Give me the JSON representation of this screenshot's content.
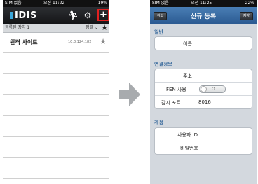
{
  "left_screen": {
    "status": {
      "carrier": "SIM 없음",
      "time": "오전 11:22",
      "battery": "19%"
    },
    "app_title": "IDIS",
    "icons": {
      "run": "running-person-icon",
      "settings": "gear-icon",
      "add": "plus-icon"
    },
    "subheader": {
      "label": "등록된 장치 1",
      "sort": "정렬 ⌄"
    },
    "devices": [
      {
        "name": "원격 사이트",
        "ip": "10.0.124.182"
      }
    ],
    "empty_rows": 6
  },
  "right_screen": {
    "status": {
      "carrier": "SIM 없음",
      "time": "오전 11:25",
      "battery": "22%"
    },
    "title": "신규 등록",
    "cancel_label": "취소",
    "save_label": "저장",
    "sections": {
      "general": {
        "title": "일반",
        "name_label": "이름"
      },
      "connection": {
        "title": "연결정보",
        "address_label": "주소",
        "fen_label": "FEN 사용",
        "fen_toggle": "O",
        "port_label": "감시 포트",
        "port_value": "8016"
      },
      "account": {
        "title": "계정",
        "user_label": "사용자 ID",
        "password_label": "비밀번호"
      }
    }
  },
  "colors": {
    "highlight": "#e02020",
    "section_text": "#3d6d9e",
    "nav_blue": "#2b5a92"
  }
}
